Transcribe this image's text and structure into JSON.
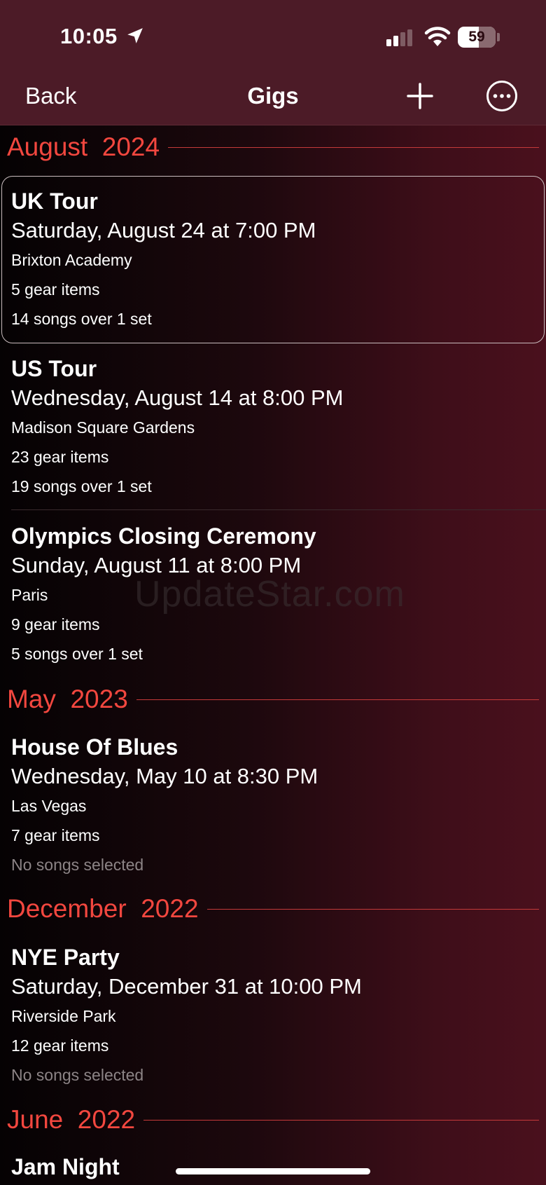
{
  "status_bar": {
    "time": "10:05",
    "battery": "59"
  },
  "nav": {
    "back_label": "Back",
    "title": "Gigs"
  },
  "sections": [
    {
      "title": "August  2024",
      "gigs": [
        {
          "name": "UK Tour",
          "date": "Saturday, August 24 at 7:00 PM",
          "venue": "Brixton Academy",
          "gear": "5 gear items",
          "songs": "14 songs over 1 set",
          "selected": true
        },
        {
          "name": "US Tour",
          "date": "Wednesday, August 14 at 8:00 PM",
          "venue": "Madison Square Gardens",
          "gear": "23 gear items",
          "songs": "19 songs over 1 set"
        },
        {
          "name": "Olympics Closing Ceremony",
          "date": "Sunday, August 11 at 8:00 PM",
          "venue": "Paris",
          "gear": "9 gear items",
          "songs": "5 songs over 1 set"
        }
      ]
    },
    {
      "title": "May  2023",
      "gigs": [
        {
          "name": "House Of Blues",
          "date": "Wednesday, May 10 at 8:30 PM",
          "venue": "Las Vegas",
          "gear": "7 gear items",
          "songs": "No songs selected"
        }
      ]
    },
    {
      "title": "December  2022",
      "gigs": [
        {
          "name": "NYE Party",
          "date": "Saturday, December 31 at 10:00 PM",
          "venue": "Riverside Park",
          "gear": "12 gear items",
          "songs": "No songs selected"
        }
      ]
    },
    {
      "title": "June  2022",
      "gigs": [
        {
          "name": "Jam Night"
        }
      ]
    }
  ],
  "watermark": "UpdateStar.com",
  "colors": {
    "accent": "#f2473f",
    "nav_bg": "#4c1b27",
    "muted": "#8c8486"
  }
}
